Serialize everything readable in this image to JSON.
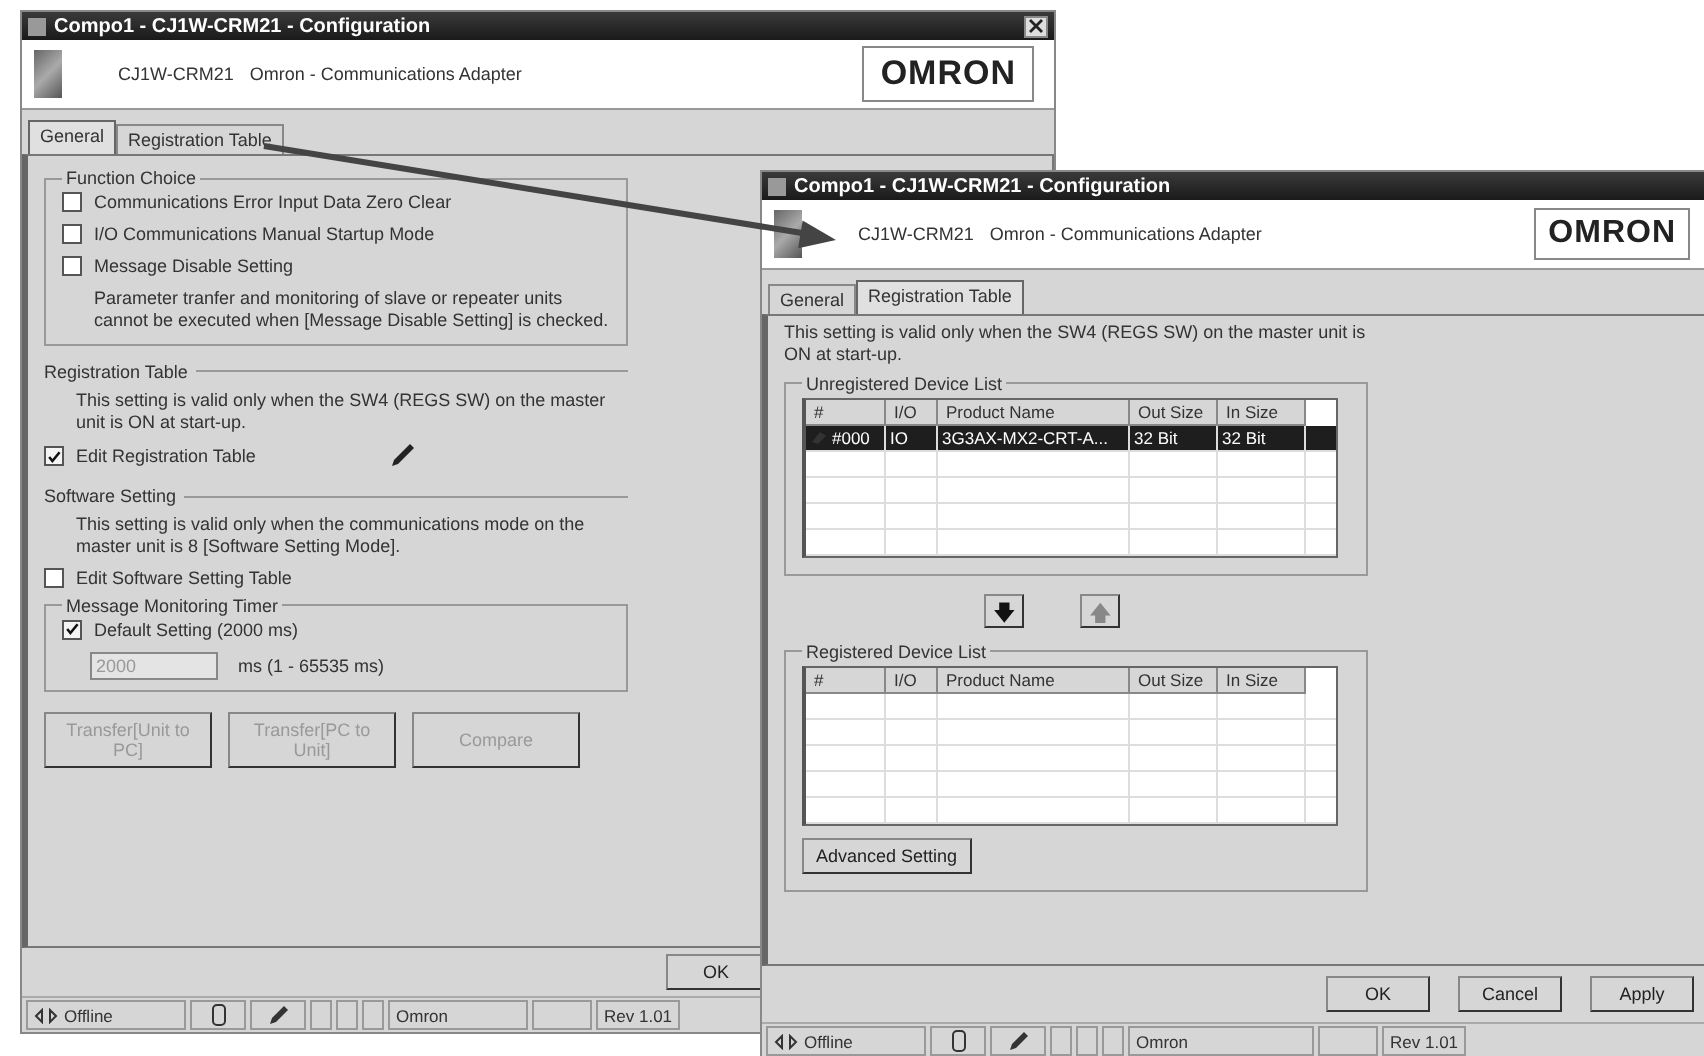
{
  "general_window": {
    "title": "Compo1 - CJ1W-CRM21 - Configuration",
    "model": "CJ1W-CRM21",
    "description": "Omron - Communications Adapter",
    "logo": "OMRON",
    "tabs": [
      {
        "label": "General",
        "selected": true
      },
      {
        "label": "Registration Table",
        "selected": false
      }
    ],
    "function_choice": {
      "title": "Function Choice",
      "options": [
        {
          "label": "Communications Error Input Data Zero Clear",
          "checked": false
        },
        {
          "label": "I/O Communications Manual Startup Mode",
          "checked": false
        },
        {
          "label": "Message Disable Setting",
          "checked": false
        }
      ],
      "note": "Parameter tranfer and monitoring of slave or repeater units cannot be executed when [Message Disable Setting] is checked."
    },
    "registration_table": {
      "title": "Registration Table",
      "note": "This setting is valid only when the SW4 (REGS SW) on the master unit is ON at start-up.",
      "option": {
        "label": "Edit Registration Table",
        "checked": true
      }
    },
    "software_setting": {
      "title": "Software Setting",
      "note": "This setting is valid only when the communications mode on the master unit is 8 [Software Setting Mode].",
      "option": {
        "label": "Edit Software Setting Table",
        "checked": false
      }
    },
    "message_monitoring_timer": {
      "title": "Message Monitoring Timer",
      "option": {
        "label": "Default Setting (2000 ms)",
        "checked": true
      },
      "value": "2000",
      "disabled": true,
      "unit": "ms (1 - 65535 ms)"
    },
    "buttons": [
      {
        "label": "Transfer[Unit to PC]",
        "disabled": true
      },
      {
        "label": "Transfer[PC to Unit]",
        "disabled": true
      },
      {
        "label": "Compare",
        "disabled": true
      }
    ],
    "ok_button": "OK",
    "status_bar": {
      "connection": "Offline",
      "vendor": "Omron",
      "revision": "Rev 1.01"
    }
  },
  "registration_window": {
    "title": "Compo1 - CJ1W-CRM21 - Configuration",
    "model": "CJ1W-CRM21",
    "description": "Omron - Communications Adapter",
    "logo": "OMRON",
    "tabs": [
      {
        "label": "General",
        "selected": false
      },
      {
        "label": "Registration Table",
        "selected": true
      }
    ],
    "note": "This setting is valid only when the SW4 (REGS SW) on the master unit is ON at start-up.",
    "unregistered": {
      "title": "Unregistered Device List",
      "columns": [
        "#",
        "I/O",
        "Product Name",
        "Out Size",
        "In Size"
      ],
      "rows": [
        {
          "cells": [
            "#000",
            "IO",
            "3G3AX-MX2-CRT-A...",
            "32 Bit",
            "32 Bit"
          ],
          "selected": true
        }
      ]
    },
    "move_down": "🡇",
    "move_up": "🡅",
    "registered": {
      "title": "Registered Device List",
      "columns": [
        "#",
        "I/O",
        "Product Name",
        "Out Size",
        "In Size"
      ]
    },
    "advanced_button": "Advanced Setting",
    "buttons": [
      "OK",
      "Cancel",
      "Apply"
    ],
    "status_bar": {
      "connection": "Offline",
      "vendor": "Omron",
      "revision": "Rev 1.01"
    }
  }
}
